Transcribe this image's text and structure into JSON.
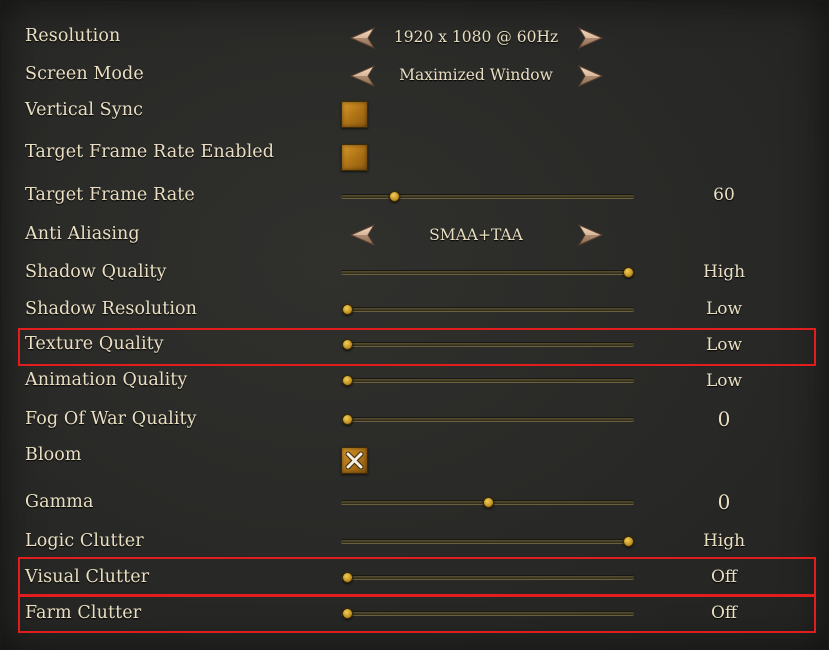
{
  "settings": {
    "resolution": {
      "label": "Resolution",
      "value": "1920 x 1080 @ 60Hz"
    },
    "screen_mode": {
      "label": "Screen Mode",
      "value": "Maximized Window"
    },
    "vertical_sync": {
      "label": "Vertical Sync",
      "checked": false
    },
    "target_frame_rate_enabled": {
      "label": "Target Frame Rate Enabled",
      "checked": false
    },
    "target_frame_rate": {
      "label": "Target Frame Rate",
      "value": "60",
      "level": 0.18
    },
    "anti_aliasing": {
      "label": "Anti Aliasing",
      "value": "SMAA+TAA"
    },
    "shadow_quality": {
      "label": "Shadow Quality",
      "value": "High",
      "level": 0.98
    },
    "shadow_resolution": {
      "label": "Shadow Resolution",
      "value": "Low",
      "level": 0.02
    },
    "texture_quality": {
      "label": "Texture Quality",
      "value": "Low",
      "level": 0.02
    },
    "animation_quality": {
      "label": "Animation Quality",
      "value": "Low",
      "level": 0.02
    },
    "fog_of_war_quality": {
      "label": "Fog Of War Quality",
      "value": "0",
      "level": 0.02
    },
    "bloom": {
      "label": "Bloom",
      "checked": true
    },
    "gamma": {
      "label": "Gamma",
      "value": "0",
      "level": 0.5
    },
    "logic_clutter": {
      "label": "Logic Clutter",
      "value": "High",
      "level": 0.98
    },
    "visual_clutter": {
      "label": "Visual Clutter",
      "value": "Off",
      "level": 0.02
    },
    "farm_clutter": {
      "label": "Farm Clutter",
      "value": "Off",
      "level": 0.02
    }
  },
  "colors": {
    "highlight": "#e11d1d",
    "accent_gold": "#d99a2c",
    "text": "#eadfc3"
  },
  "icons": {
    "prev": "arrow-left-icon",
    "next": "arrow-right-icon",
    "check": "x-mark-icon"
  }
}
